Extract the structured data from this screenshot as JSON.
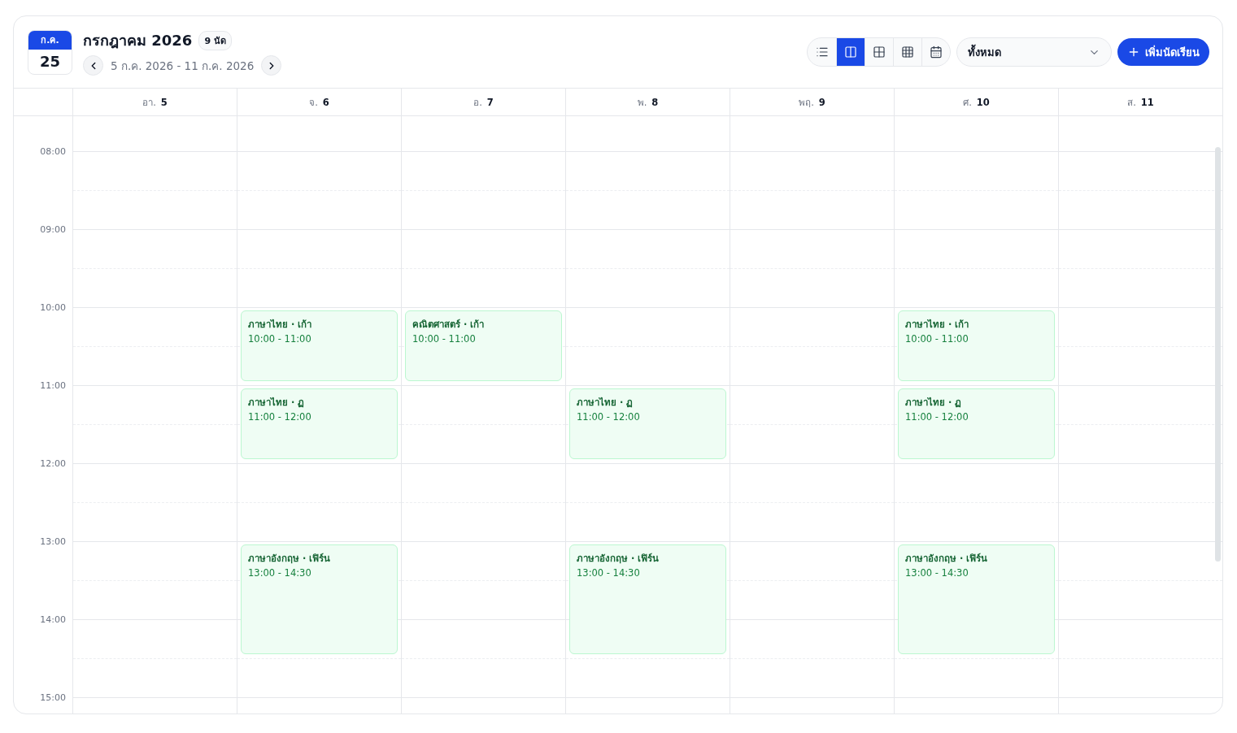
{
  "header": {
    "date_badge": {
      "month": "ก.ค.",
      "day": "25"
    },
    "title": "กรกฎาคม 2026",
    "count": "9 นัด",
    "range": "5 ก.ค. 2026 - 11 ก.ค. 2026",
    "view_options": [
      {
        "kind": "list",
        "selected": false
      },
      {
        "kind": "week",
        "selected": true
      },
      {
        "kind": "grid",
        "selected": false
      },
      {
        "kind": "month",
        "selected": false
      },
      {
        "kind": "calendar",
        "selected": false
      }
    ],
    "filter": {
      "value": "ทั้งหมด"
    },
    "add_button": {
      "label": "เพิ่มนัดเรียน"
    }
  },
  "time_labels": [
    "08:00",
    "09:00",
    "10:00",
    "11:00",
    "12:00",
    "13:00",
    "14:00",
    "15:00"
  ],
  "days": [
    {
      "weekday": "อา.",
      "date": "5"
    },
    {
      "weekday": "จ.",
      "date": "6",
      "events": [
        {
          "title": "ภาษาไทย · เก้า",
          "time": "10:00 - 11:00"
        },
        {
          "title": "ภาษาไทย · ฏ",
          "time": "11:00 - 12:00"
        },
        {
          "title": "ภาษาอังกฤษ · เฟิร์น",
          "time": "13:00 - 14:30"
        }
      ]
    },
    {
      "weekday": "อ.",
      "date": "7",
      "events": [
        {
          "title": "คณิตศาสตร์ · เก้า",
          "time": "10:00 - 11:00"
        }
      ]
    },
    {
      "weekday": "พ.",
      "date": "8",
      "events": [
        {
          "title": "ภาษาไทย · ฏ",
          "time": "11:00 - 12:00"
        },
        {
          "title": "ภาษาอังกฤษ · เฟิร์น",
          "time": "13:00 - 14:30"
        }
      ]
    },
    {
      "weekday": "พฤ.",
      "date": "9"
    },
    {
      "weekday": "ศ.",
      "date": "10",
      "events": [
        {
          "title": "ภาษาไทย · เก้า",
          "time": "10:00 - 11:00"
        },
        {
          "title": "ภาษาไทย · ฏ",
          "time": "11:00 - 12:00"
        },
        {
          "title": "ภาษาอังกฤษ · เฟิร์น",
          "time": "13:00 - 14:30"
        }
      ]
    },
    {
      "weekday": "ส.",
      "date": "11"
    }
  ]
}
